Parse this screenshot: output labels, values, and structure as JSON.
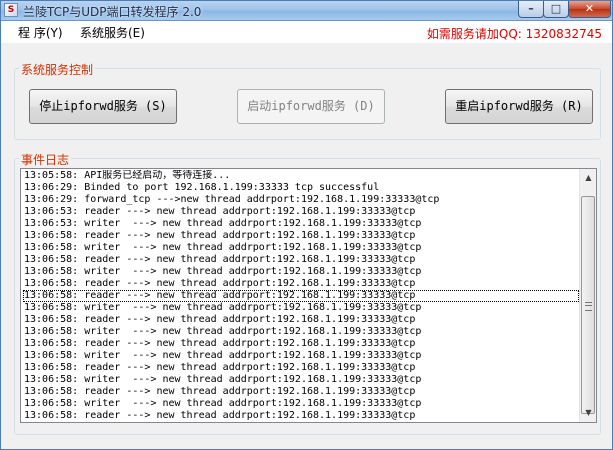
{
  "window": {
    "title": "兰陵TCP与UDP端口转发程序 2.0",
    "icon_glyph": "S",
    "minimize_glyph": "–",
    "maximize_glyph": "□",
    "close_glyph": "✕"
  },
  "menubar": {
    "items": [
      "程 序(Y)",
      "系统服务(E)"
    ],
    "contact": "如需服务请加QQ: 1320832745"
  },
  "service_control": {
    "label": "系统服务控制",
    "stop_button": "停止ipforwd服务 (S)",
    "start_button": "启动ipforwd服务 (D)",
    "restart_button": "重启ipforwd服务 (R)"
  },
  "event_log": {
    "label": "事件日志",
    "selected_index": 10,
    "lines": [
      "13:05:58: API服务已经启动，等待连接...",
      "13:06:29: Binded to port 192.168.1.199:33333 tcp successful",
      "13:06:29: forward_tcp --->new thread addrport:192.168.1.199:33333@tcp",
      "13:06:53: reader ---> new thread addrport:192.168.1.199:33333@tcp",
      "13:06:53: writer  ---> new thread addrport:192.168.1.199:33333@tcp",
      "13:06:58: reader ---> new thread addrport:192.168.1.199:33333@tcp",
      "13:06:58: writer  ---> new thread addrport:192.168.1.199:33333@tcp",
      "13:06:58: reader ---> new thread addrport:192.168.1.199:33333@tcp",
      "13:06:58: writer  ---> new thread addrport:192.168.1.199:33333@tcp",
      "13:06:58: reader ---> new thread addrport:192.168.1.199:33333@tcp",
      "13:06:58: reader ---> new thread addrport:192.168.1.199:33333@tcp",
      "13:06:58: writer  ---> new thread addrport:192.168.1.199:33333@tcp",
      "13:06:58: reader ---> new thread addrport:192.168.1.199:33333@tcp",
      "13:06:58: writer  ---> new thread addrport:192.168.1.199:33333@tcp",
      "13:06:58: reader ---> new thread addrport:192.168.1.199:33333@tcp",
      "13:06:58: writer  ---> new thread addrport:192.168.1.199:33333@tcp",
      "13:06:58: reader ---> new thread addrport:192.168.1.199:33333@tcp",
      "13:06:58: writer  ---> new thread addrport:192.168.1.199:33333@tcp",
      "13:06:58: reader ---> new thread addrport:192.168.1.199:33333@tcp",
      "13:06:58: writer  ---> new thread addrport:192.168.1.199:33333@tcp",
      "13:06:58: reader ---> new thread addrport:192.168.1.199:33333@tcp",
      "13:06:58: writer  ---> new thread addrport:192.168.1.199:33333@tcp"
    ]
  }
}
